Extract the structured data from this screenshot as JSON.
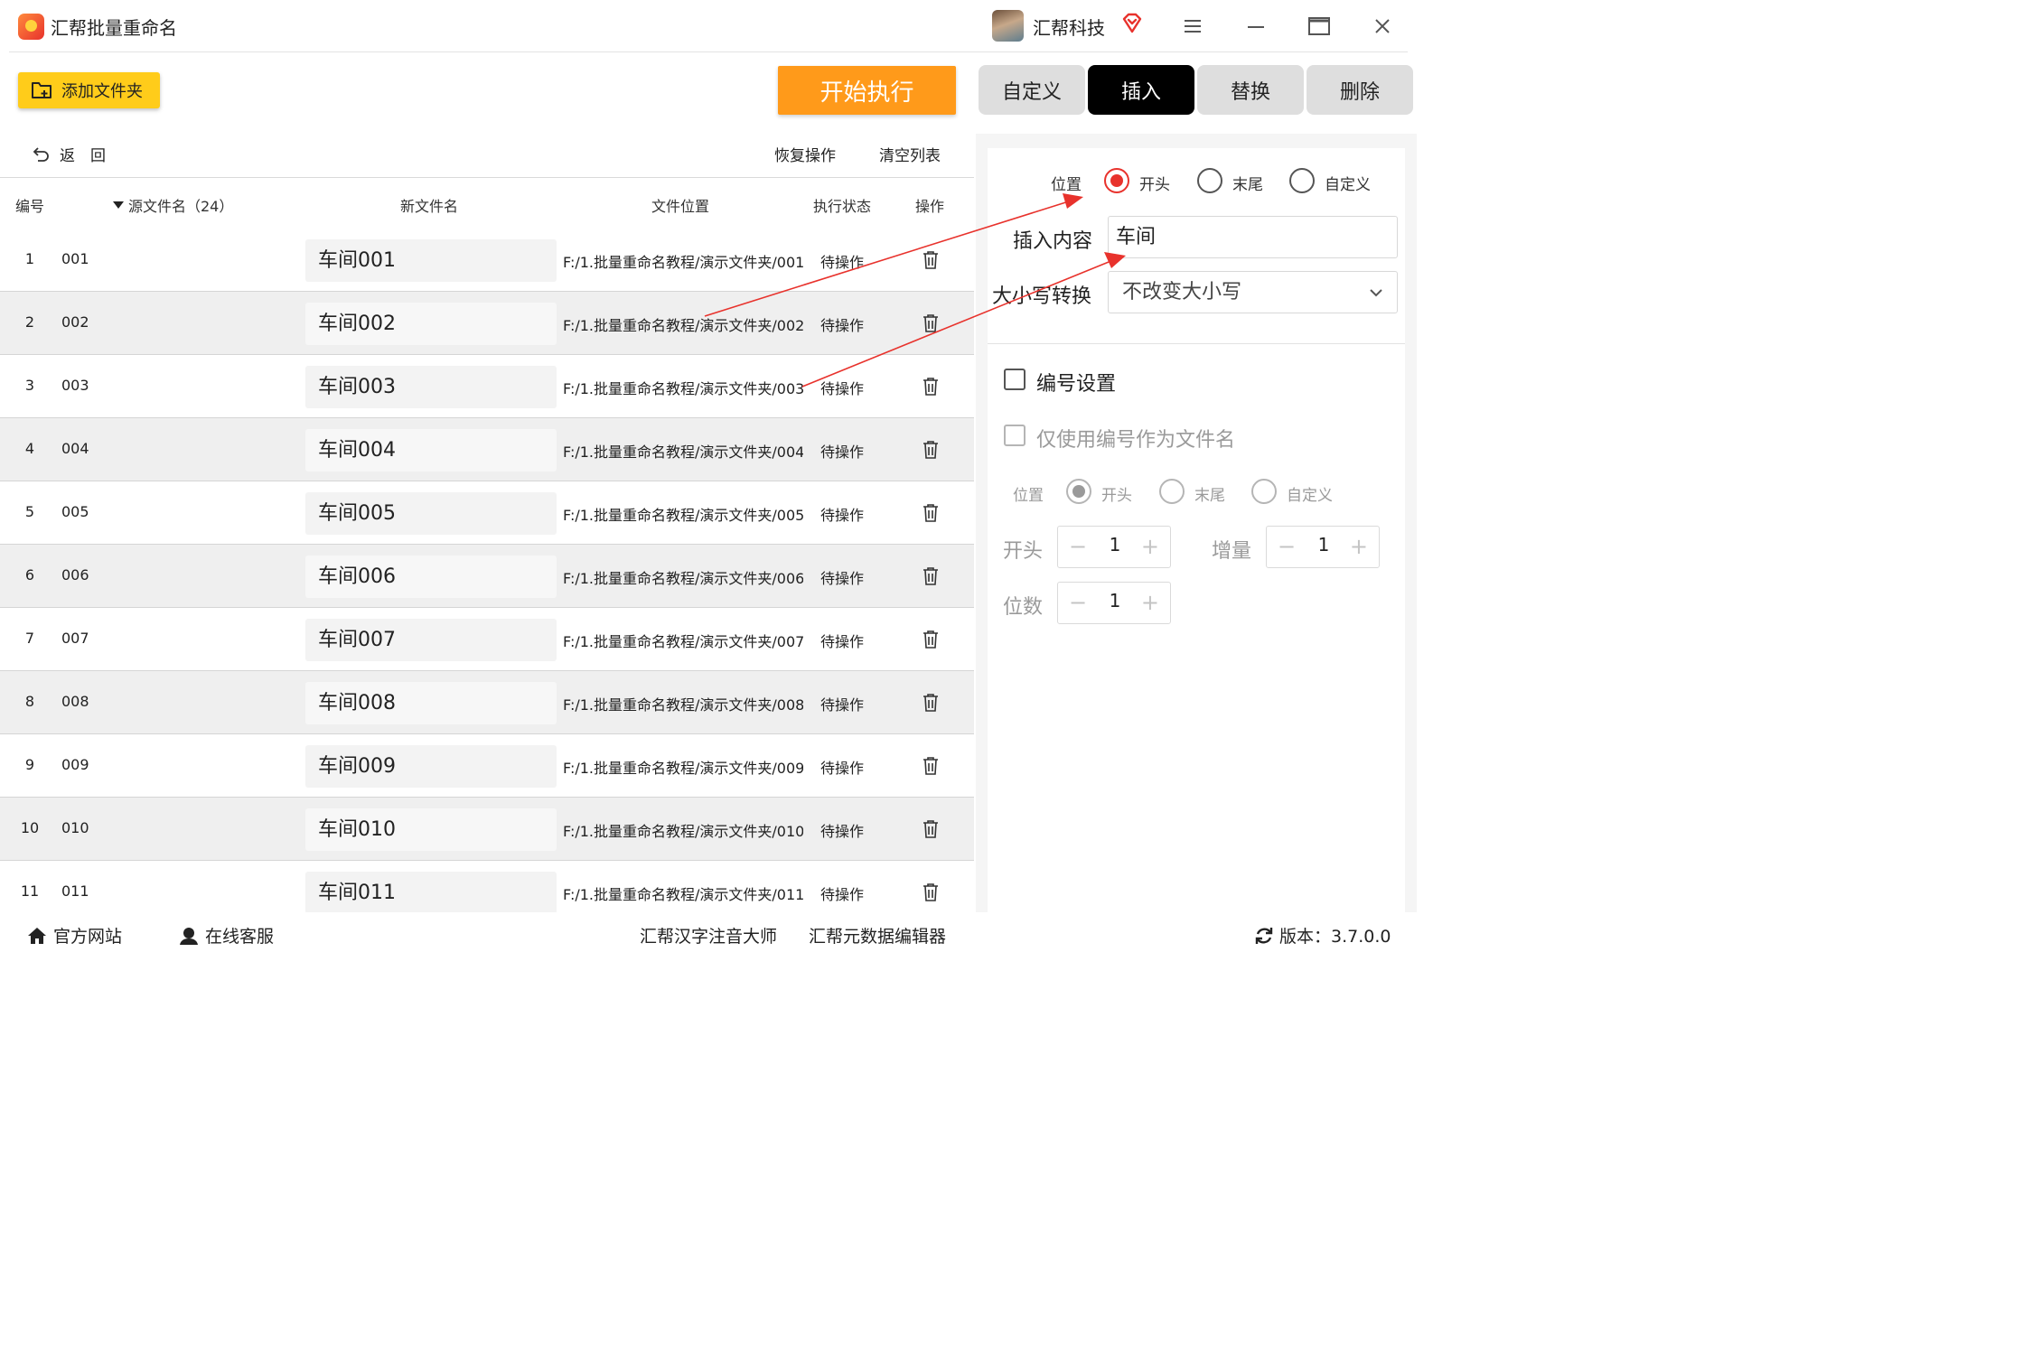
{
  "app": {
    "title": "汇帮批量重命名",
    "account_name": "汇帮科技"
  },
  "toolbar": {
    "add_folder_label": "添加文件夹",
    "start_label": "开始执行",
    "tabs": [
      "自定义",
      "插入",
      "替换",
      "删除"
    ],
    "active_tab": "插入"
  },
  "list_actions": {
    "back_label": "返　回",
    "restore_label": "恢复操作",
    "clear_label": "清空列表"
  },
  "columns": {
    "index": "编号",
    "source": "源文件名（24）",
    "new_name": "新文件名",
    "location": "文件位置",
    "status": "执行状态",
    "action": "操作"
  },
  "rows": [
    {
      "index": "1",
      "source": "001",
      "new_name": "车间001",
      "location": "F:/1.批量重命名教程/演示文件夹/001",
      "status": "待操作"
    },
    {
      "index": "2",
      "source": "002",
      "new_name": "车间002",
      "location": "F:/1.批量重命名教程/演示文件夹/002",
      "status": "待操作"
    },
    {
      "index": "3",
      "source": "003",
      "new_name": "车间003",
      "location": "F:/1.批量重命名教程/演示文件夹/003",
      "status": "待操作"
    },
    {
      "index": "4",
      "source": "004",
      "new_name": "车间004",
      "location": "F:/1.批量重命名教程/演示文件夹/004",
      "status": "待操作"
    },
    {
      "index": "5",
      "source": "005",
      "new_name": "车间005",
      "location": "F:/1.批量重命名教程/演示文件夹/005",
      "status": "待操作"
    },
    {
      "index": "6",
      "source": "006",
      "new_name": "车间006",
      "location": "F:/1.批量重命名教程/演示文件夹/006",
      "status": "待操作"
    },
    {
      "index": "7",
      "source": "007",
      "new_name": "车间007",
      "location": "F:/1.批量重命名教程/演示文件夹/007",
      "status": "待操作"
    },
    {
      "index": "8",
      "source": "008",
      "new_name": "车间008",
      "location": "F:/1.批量重命名教程/演示文件夹/008",
      "status": "待操作"
    },
    {
      "index": "9",
      "source": "009",
      "new_name": "车间009",
      "location": "F:/1.批量重命名教程/演示文件夹/009",
      "status": "待操作"
    },
    {
      "index": "10",
      "source": "010",
      "new_name": "车间010",
      "location": "F:/1.批量重命名教程/演示文件夹/010",
      "status": "待操作"
    },
    {
      "index": "11",
      "source": "011",
      "new_name": "车间011",
      "location": "F:/1.批量重命名教程/演示文件夹/011",
      "status": "待操作"
    }
  ],
  "insert_settings": {
    "position_label": "位置",
    "position_options": [
      "开头",
      "末尾",
      "自定义"
    ],
    "position_selected": "开头",
    "content_label": "插入内容",
    "content_value": "车间",
    "case_label": "大小写转换",
    "case_value": "不改变大小写"
  },
  "numbering": {
    "enable_label": "编号设置",
    "only_number_label": "仅使用编号作为文件名",
    "position_label": "位置",
    "position_options": [
      "开头",
      "末尾",
      "自定义"
    ],
    "start_label": "开头",
    "start_value": "1",
    "increment_label": "增量",
    "increment_value": "1",
    "digits_label": "位数",
    "digits_value": "1"
  },
  "footer": {
    "website": "官方网站",
    "support": "在线客服",
    "product1": "汇帮汉字注音大师",
    "product2": "汇帮元数据编辑器",
    "version": "版本：3.7.0.0"
  },
  "colors": {
    "accent": "#e8322c",
    "start": "#ff9a1a",
    "add_folder": "#ffcc1a"
  }
}
